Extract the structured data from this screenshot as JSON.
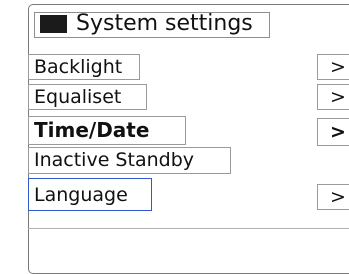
{
  "header": {
    "title": "System settings",
    "icon_name": "battery-icon"
  },
  "menu": {
    "items": [
      {
        "label": "Backlight",
        "arrow": ">",
        "bold": false,
        "selected": false
      },
      {
        "label": "Equaliset",
        "arrow": ">",
        "bold": false,
        "selected": false
      },
      {
        "label": "Time/Date",
        "arrow": ">",
        "bold": true,
        "selected": false
      },
      {
        "label": "Inactive Standby",
        "arrow": "",
        "bold": false,
        "selected": false
      },
      {
        "label": "Language",
        "arrow": ">",
        "bold": false,
        "selected": true
      }
    ]
  },
  "colors": {
    "selection_border": "#3357d1",
    "text": "#111111",
    "background": "#ffffff"
  }
}
